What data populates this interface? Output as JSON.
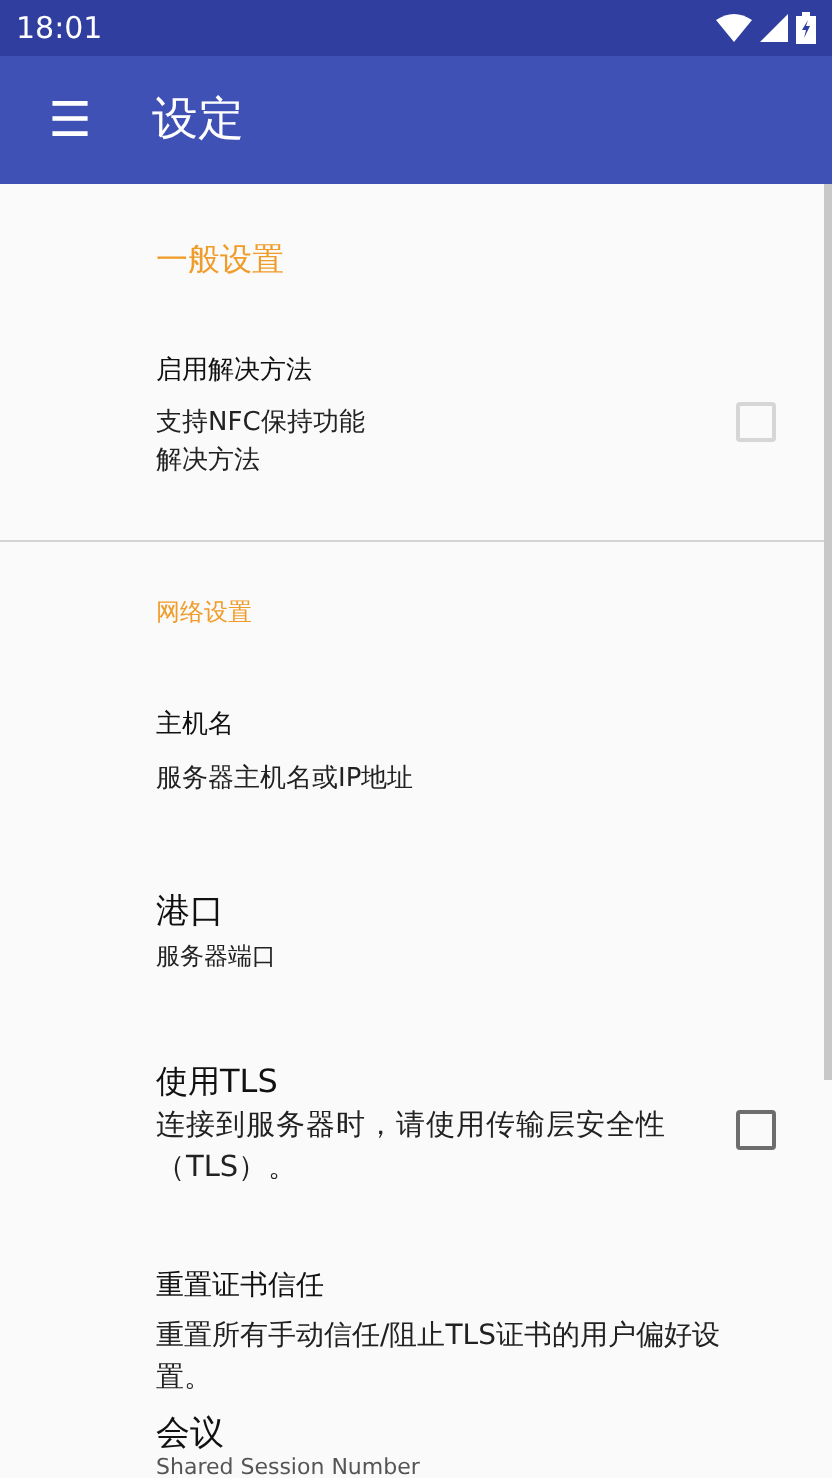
{
  "status_bar": {
    "time": "18:01"
  },
  "app_bar": {
    "menu_icon": "☰",
    "title": "设定"
  },
  "items": [
    {
      "kind": "heading",
      "title": "一般设置"
    },
    {
      "kind": "checkbox",
      "title": "启用解决方法",
      "summary": "支持NFC保持功能解决方法",
      "checked": false,
      "disabled": true
    },
    {
      "kind": "divider"
    },
    {
      "kind": "subheading",
      "title": "网络设置"
    },
    {
      "kind": "text",
      "title": "主机名",
      "summary": "服务器主机名或IP地址"
    },
    {
      "kind": "text",
      "title": "港口",
      "summary": "服务器端口"
    },
    {
      "kind": "checkbox",
      "title": "使用TLS",
      "summary": "连接到服务器时，请使用传输层安全性（TLS）。",
      "checked": false,
      "disabled": false
    },
    {
      "kind": "text",
      "title": "重置证书信任",
      "summary": "重置所有手动信任/阻止TLS证书的用户偏好设置。"
    },
    {
      "kind": "text",
      "title": "会议",
      "summary": "Shared Session Number"
    }
  ]
}
